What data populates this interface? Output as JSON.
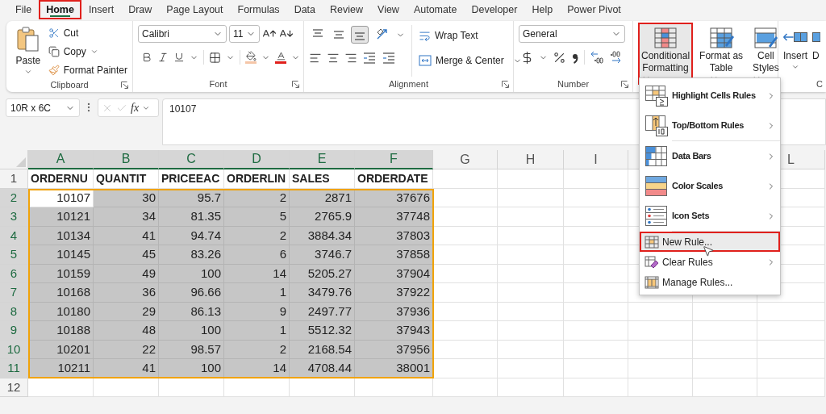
{
  "menu_tabs": [
    {
      "label": "File",
      "selected": false,
      "highlighted": false
    },
    {
      "label": "Home",
      "selected": true,
      "highlighted": true
    },
    {
      "label": "Insert",
      "selected": false,
      "highlighted": false
    },
    {
      "label": "Draw",
      "selected": false,
      "highlighted": false
    },
    {
      "label": "Page Layout",
      "selected": false,
      "highlighted": false
    },
    {
      "label": "Formulas",
      "selected": false,
      "highlighted": false
    },
    {
      "label": "Data",
      "selected": false,
      "highlighted": false
    },
    {
      "label": "Review",
      "selected": false,
      "highlighted": false
    },
    {
      "label": "View",
      "selected": false,
      "highlighted": false
    },
    {
      "label": "Automate",
      "selected": false,
      "highlighted": false
    },
    {
      "label": "Developer",
      "selected": false,
      "highlighted": false
    },
    {
      "label": "Help",
      "selected": false,
      "highlighted": false
    },
    {
      "label": "Power Pivot",
      "selected": false,
      "highlighted": false
    }
  ],
  "ribbon": {
    "clipboard": {
      "label": "Clipboard",
      "paste": "Paste",
      "cut": "Cut",
      "copy": "Copy",
      "format_painter": "Format Painter"
    },
    "font": {
      "label": "Font",
      "font_name": "Calibri",
      "font_size": "11"
    },
    "alignment": {
      "label": "Alignment",
      "wrap_text": "Wrap Text",
      "merge_center": "Merge & Center",
      "vertical_align": [
        {
          "kind": "top",
          "selected": false
        },
        {
          "kind": "middle",
          "selected": false
        },
        {
          "kind": "bottom",
          "selected": true
        }
      ]
    },
    "number": {
      "label": "Number",
      "format": "General"
    },
    "styles": [
      {
        "kind": "conditional",
        "lines": [
          "Conditional",
          "Formatting"
        ],
        "highlighted": true,
        "expanded": true
      },
      {
        "kind": "table",
        "lines": [
          "Format as",
          "Table"
        ],
        "highlighted": false,
        "expanded": false
      },
      {
        "kind": "cell",
        "lines": [
          "Cell",
          "Styles"
        ],
        "highlighted": false,
        "expanded": false
      }
    ],
    "cells": {
      "label": "C",
      "insert": "Insert",
      "delete": "D"
    }
  },
  "formula_bar": {
    "name_box": "10R x 6C",
    "fx": "fx",
    "value": "10107"
  },
  "sheet": {
    "columns": [
      {
        "label": "A",
        "selected": true
      },
      {
        "label": "B",
        "selected": true
      },
      {
        "label": "C",
        "selected": true
      },
      {
        "label": "D",
        "selected": true
      },
      {
        "label": "E",
        "selected": true
      },
      {
        "label": "F",
        "selected": true
      },
      {
        "label": "G",
        "selected": false
      },
      {
        "label": "H",
        "selected": false
      },
      {
        "label": "I",
        "selected": false
      },
      {
        "label": "L",
        "selected": false
      }
    ],
    "header_row": {
      "header": "1",
      "cells": [
        "ORDERNU",
        "QUANTIT",
        "PRICEEAC",
        "ORDERLIN",
        "SALES",
        "ORDERDATE"
      ]
    },
    "rows": [
      {
        "header": "2",
        "selected": true,
        "active": true,
        "cells": [
          "10107",
          "30",
          "95.7",
          "2",
          "2871",
          "37676"
        ]
      },
      {
        "header": "3",
        "selected": true,
        "active": false,
        "cells": [
          "10121",
          "34",
          "81.35",
          "5",
          "2765.9",
          "37748"
        ]
      },
      {
        "header": "4",
        "selected": true,
        "active": false,
        "cells": [
          "10134",
          "41",
          "94.74",
          "2",
          "3884.34",
          "37803"
        ]
      },
      {
        "header": "5",
        "selected": true,
        "active": false,
        "cells": [
          "10145",
          "45",
          "83.26",
          "6",
          "3746.7",
          "37858"
        ]
      },
      {
        "header": "6",
        "selected": true,
        "active": false,
        "cells": [
          "10159",
          "49",
          "100",
          "14",
          "5205.27",
          "37904"
        ]
      },
      {
        "header": "7",
        "selected": true,
        "active": false,
        "cells": [
          "10168",
          "36",
          "96.66",
          "1",
          "3479.76",
          "37922"
        ]
      },
      {
        "header": "8",
        "selected": true,
        "active": false,
        "cells": [
          "10180",
          "29",
          "86.13",
          "9",
          "2497.77",
          "37936"
        ]
      },
      {
        "header": "9",
        "selected": true,
        "active": false,
        "cells": [
          "10188",
          "48",
          "100",
          "1",
          "5512.32",
          "37943"
        ]
      },
      {
        "header": "10",
        "selected": true,
        "active": false,
        "cells": [
          "10201",
          "22",
          "98.57",
          "2",
          "2168.54",
          "37956"
        ]
      },
      {
        "header": "11",
        "selected": true,
        "active": false,
        "cells": [
          "10211",
          "41",
          "100",
          "14",
          "4708.44",
          "38001"
        ]
      },
      {
        "header": "12",
        "selected": false
      }
    ]
  },
  "cf_menu": [
    {
      "kind": "highlight",
      "label": "Highlight Cells Rules",
      "submenu": true,
      "separator": false,
      "hovered": false,
      "highlighted": false
    },
    {
      "kind": "topbottom",
      "label": "Top/Bottom Rules",
      "submenu": true,
      "separator": false,
      "hovered": false,
      "highlighted": false
    },
    {
      "kind": "databars",
      "label": "Data Bars",
      "submenu": true,
      "separator": true,
      "hovered": false,
      "highlighted": false
    },
    {
      "kind": "colorscales",
      "label": "Color Scales",
      "submenu": true,
      "separator": false,
      "hovered": false,
      "highlighted": false
    },
    {
      "kind": "iconsets",
      "label": "Icon Sets",
      "submenu": true,
      "separator": false,
      "hovered": false,
      "highlighted": false
    },
    {
      "kind": "newrule",
      "label": "New Rule...",
      "submenu": false,
      "separator": true,
      "hovered": true,
      "highlighted": true
    },
    {
      "kind": "clearrules",
      "label": "Clear Rules",
      "submenu": true,
      "separator": false,
      "hovered": false,
      "highlighted": false
    },
    {
      "kind": "managerules",
      "label": "Manage Rules...",
      "submenu": false,
      "separator": false,
      "hovered": false,
      "highlighted": false
    }
  ]
}
